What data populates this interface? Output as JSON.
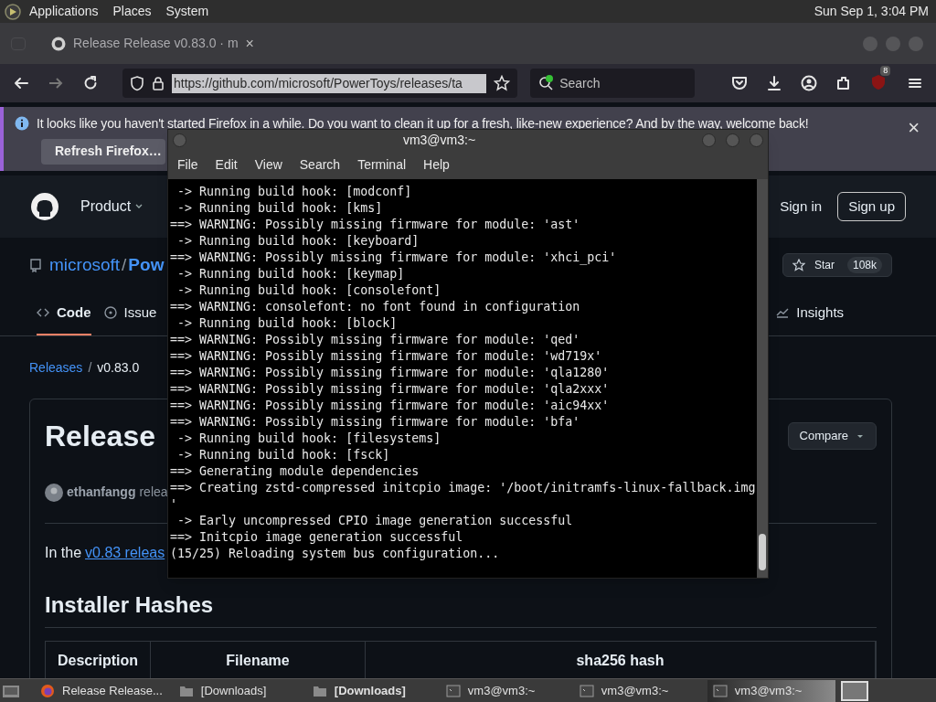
{
  "top_panel": {
    "menus": [
      "Applications",
      "Places",
      "System"
    ],
    "clock": "Sun Sep 1, 3:04 PM"
  },
  "browser": {
    "tab": {
      "title": "Release Release v0.83.0 · m",
      "close": "×"
    },
    "url": "https://github.com/microsoft/PowerToys/releases/ta",
    "search": {
      "placeholder": "Search"
    },
    "badge": "8",
    "notice": {
      "text": "It looks like you haven't started Firefox in a while. Do you want to clean it up for a fresh, like-new experience? And by the way, welcome back!",
      "button": "Refresh Firefox…",
      "close": "×"
    }
  },
  "github": {
    "nav": {
      "product": "Product",
      "sign_in": "Sign in",
      "sign_up": "Sign up"
    },
    "repo": {
      "owner": "microsoft",
      "separator": "/",
      "name": "Pow",
      "star_label": "Star",
      "star_count": "108k"
    },
    "tabs": [
      {
        "label": "Code",
        "selected": true
      },
      {
        "label": "Issue",
        "selected": false
      },
      {
        "label": "Insights",
        "selected": false
      }
    ],
    "breadcrumb": {
      "link": "Releases",
      "separator": "/",
      "current": "v0.83.0"
    },
    "release": {
      "title": "Release",
      "compare": "Compare",
      "author": "ethanfangg",
      "author_rest": "relea",
      "intro": "In the",
      "intro_link": "v0.83 releas",
      "section": "Installer Hashes",
      "table": {
        "columns": [
          "Description",
          "Filename",
          "sha256 hash"
        ]
      }
    }
  },
  "terminal": {
    "title": "vm3@vm3:~",
    "menus": [
      "File",
      "Edit",
      "View",
      "Search",
      "Terminal",
      "Help"
    ],
    "lines": [
      " -> Running build hook: [modconf]",
      " -> Running build hook: [kms]",
      "==> WARNING: Possibly missing firmware for module: 'ast'",
      " -> Running build hook: [keyboard]",
      "==> WARNING: Possibly missing firmware for module: 'xhci_pci'",
      " -> Running build hook: [keymap]",
      " -> Running build hook: [consolefont]",
      "==> WARNING: consolefont: no font found in configuration",
      " -> Running build hook: [block]",
      "==> WARNING: Possibly missing firmware for module: 'qed'",
      "==> WARNING: Possibly missing firmware for module: 'wd719x'",
      "==> WARNING: Possibly missing firmware for module: 'qla1280'",
      "==> WARNING: Possibly missing firmware for module: 'qla2xxx'",
      "==> WARNING: Possibly missing firmware for module: 'aic94xx'",
      "==> WARNING: Possibly missing firmware for module: 'bfa'",
      " -> Running build hook: [filesystems]",
      " -> Running build hook: [fsck]",
      "==> Generating module dependencies",
      "==> Creating zstd-compressed initcpio image: '/boot/initramfs-linux-fallback.img",
      "'",
      " -> Early uncompressed CPIO image generation successful",
      "==> Initcpio image generation successful",
      "(15/25) Reloading system bus configuration..."
    ]
  },
  "taskbar": [
    {
      "kind": "firefox",
      "label": "Release Release...",
      "selected": false,
      "bold": false
    },
    {
      "kind": "folder",
      "label": "[Downloads]",
      "selected": false,
      "bold": false
    },
    {
      "kind": "folder",
      "label": "[Downloads]",
      "selected": false,
      "bold": true
    },
    {
      "kind": "terminal",
      "label": "vm3@vm3:~",
      "selected": false,
      "bold": false
    },
    {
      "kind": "terminal",
      "label": "vm3@vm3:~",
      "selected": false,
      "bold": false
    },
    {
      "kind": "terminal",
      "label": "vm3@vm3:~",
      "selected": true,
      "bold": false
    }
  ]
}
